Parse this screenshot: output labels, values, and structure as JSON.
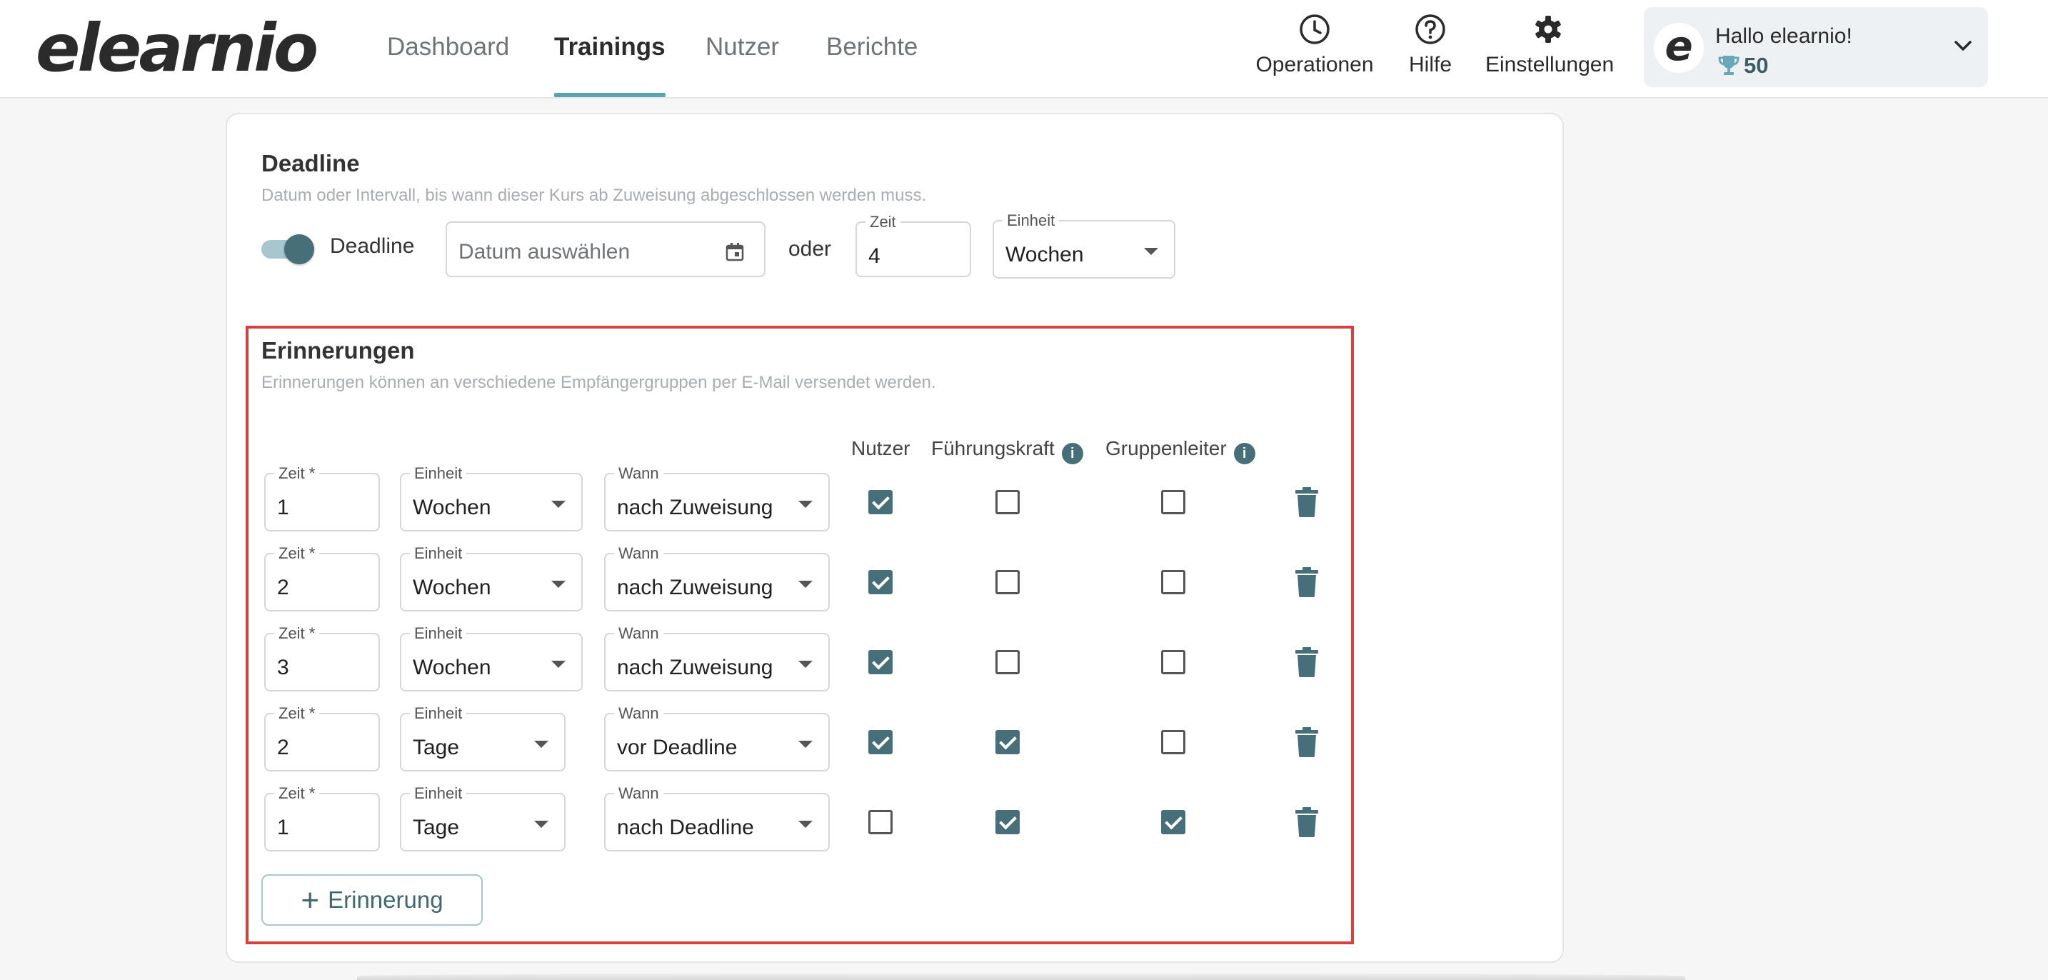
{
  "header": {
    "logo": "elearnio",
    "nav": [
      {
        "label": "Dashboard",
        "active": false
      },
      {
        "label": "Trainings",
        "active": true
      },
      {
        "label": "Nutzer",
        "active": false
      },
      {
        "label": "Berichte",
        "active": false
      }
    ],
    "tools": [
      {
        "label": "Operationen",
        "icon": "clock-icon"
      },
      {
        "label": "Hilfe",
        "icon": "help-icon"
      },
      {
        "label": "Einstellungen",
        "icon": "gear-icon"
      }
    ],
    "account": {
      "avatar_letter": "e",
      "greeting": "Hallo elearnio!",
      "points": "50",
      "points_icon": "trophy-icon"
    }
  },
  "deadline": {
    "title": "Deadline",
    "description": "Datum oder Intervall, bis wann dieser Kurs ab Zuweisung abgeschlossen werden muss.",
    "toggle_label": "Deadline",
    "toggle_on": true,
    "date_placeholder": "Datum auswählen",
    "or_label": "oder",
    "time_label": "Zeit",
    "time_value": "4",
    "unit_label": "Einheit",
    "unit_value": "Wochen"
  },
  "reminders": {
    "title": "Erinnerungen",
    "description": "Erinnerungen können an verschiedene Empfängergruppen per E-Mail versendet werden.",
    "columns": {
      "user": "Nutzer",
      "manager": "Führungskraft",
      "group_lead": "Gruppenleiter"
    },
    "field_labels": {
      "time": "Zeit *",
      "unit": "Einheit",
      "when": "Wann"
    },
    "rows": [
      {
        "time": "1",
        "unit": "Wochen",
        "when": "nach Zuweisung",
        "user": true,
        "manager": false,
        "group_lead": false
      },
      {
        "time": "2",
        "unit": "Wochen",
        "when": "nach Zuweisung",
        "user": true,
        "manager": false,
        "group_lead": false
      },
      {
        "time": "3",
        "unit": "Wochen",
        "when": "nach Zuweisung",
        "user": true,
        "manager": false,
        "group_lead": false
      },
      {
        "time": "2",
        "unit": "Tage",
        "when": "vor Deadline",
        "user": true,
        "manager": true,
        "group_lead": false
      },
      {
        "time": "1",
        "unit": "Tage",
        "when": "nach Deadline",
        "user": false,
        "manager": true,
        "group_lead": true
      }
    ],
    "add_button": "Erinnerung"
  },
  "colors": {
    "accent": "#476f79",
    "nav_underline": "#5aa3b5",
    "highlight_border": "#d9403a"
  }
}
